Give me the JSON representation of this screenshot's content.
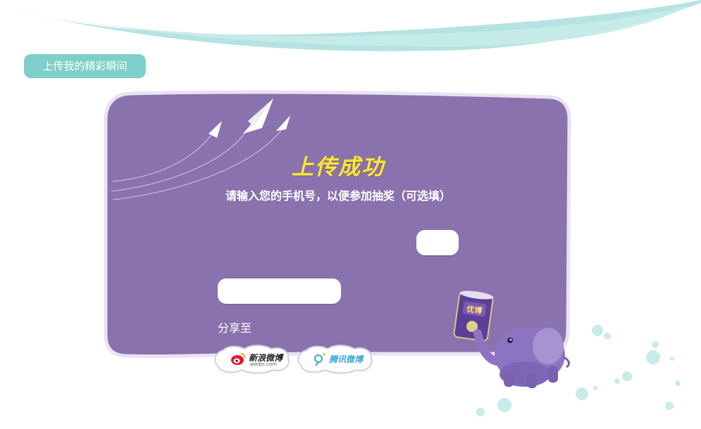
{
  "header": {
    "tab_label": "上传我的精彩瞬间"
  },
  "panel": {
    "title": "上传成功",
    "subtitle": "请输入您的手机号，以便参加抽奖（可选填）",
    "phone_input_value": "",
    "submit_label": ""
  },
  "share": {
    "label": "分享至",
    "sina": {
      "name": "新浪微博",
      "domain": "weibo.com"
    },
    "tencent": {
      "name": "腾讯微博"
    }
  },
  "product": {
    "brand": "优博"
  },
  "colors": {
    "panel": "#8a72ae",
    "panel_border": "#e9e2f2",
    "tab": "#7ecfc9",
    "title": "#ffe928",
    "wave": "#a8dedd",
    "bubbles": "#c9ebea"
  },
  "icons": [
    "paper-plane-icon",
    "sina-weibo-icon",
    "tencent-weibo-icon",
    "elephant-mascot",
    "milk-can"
  ]
}
